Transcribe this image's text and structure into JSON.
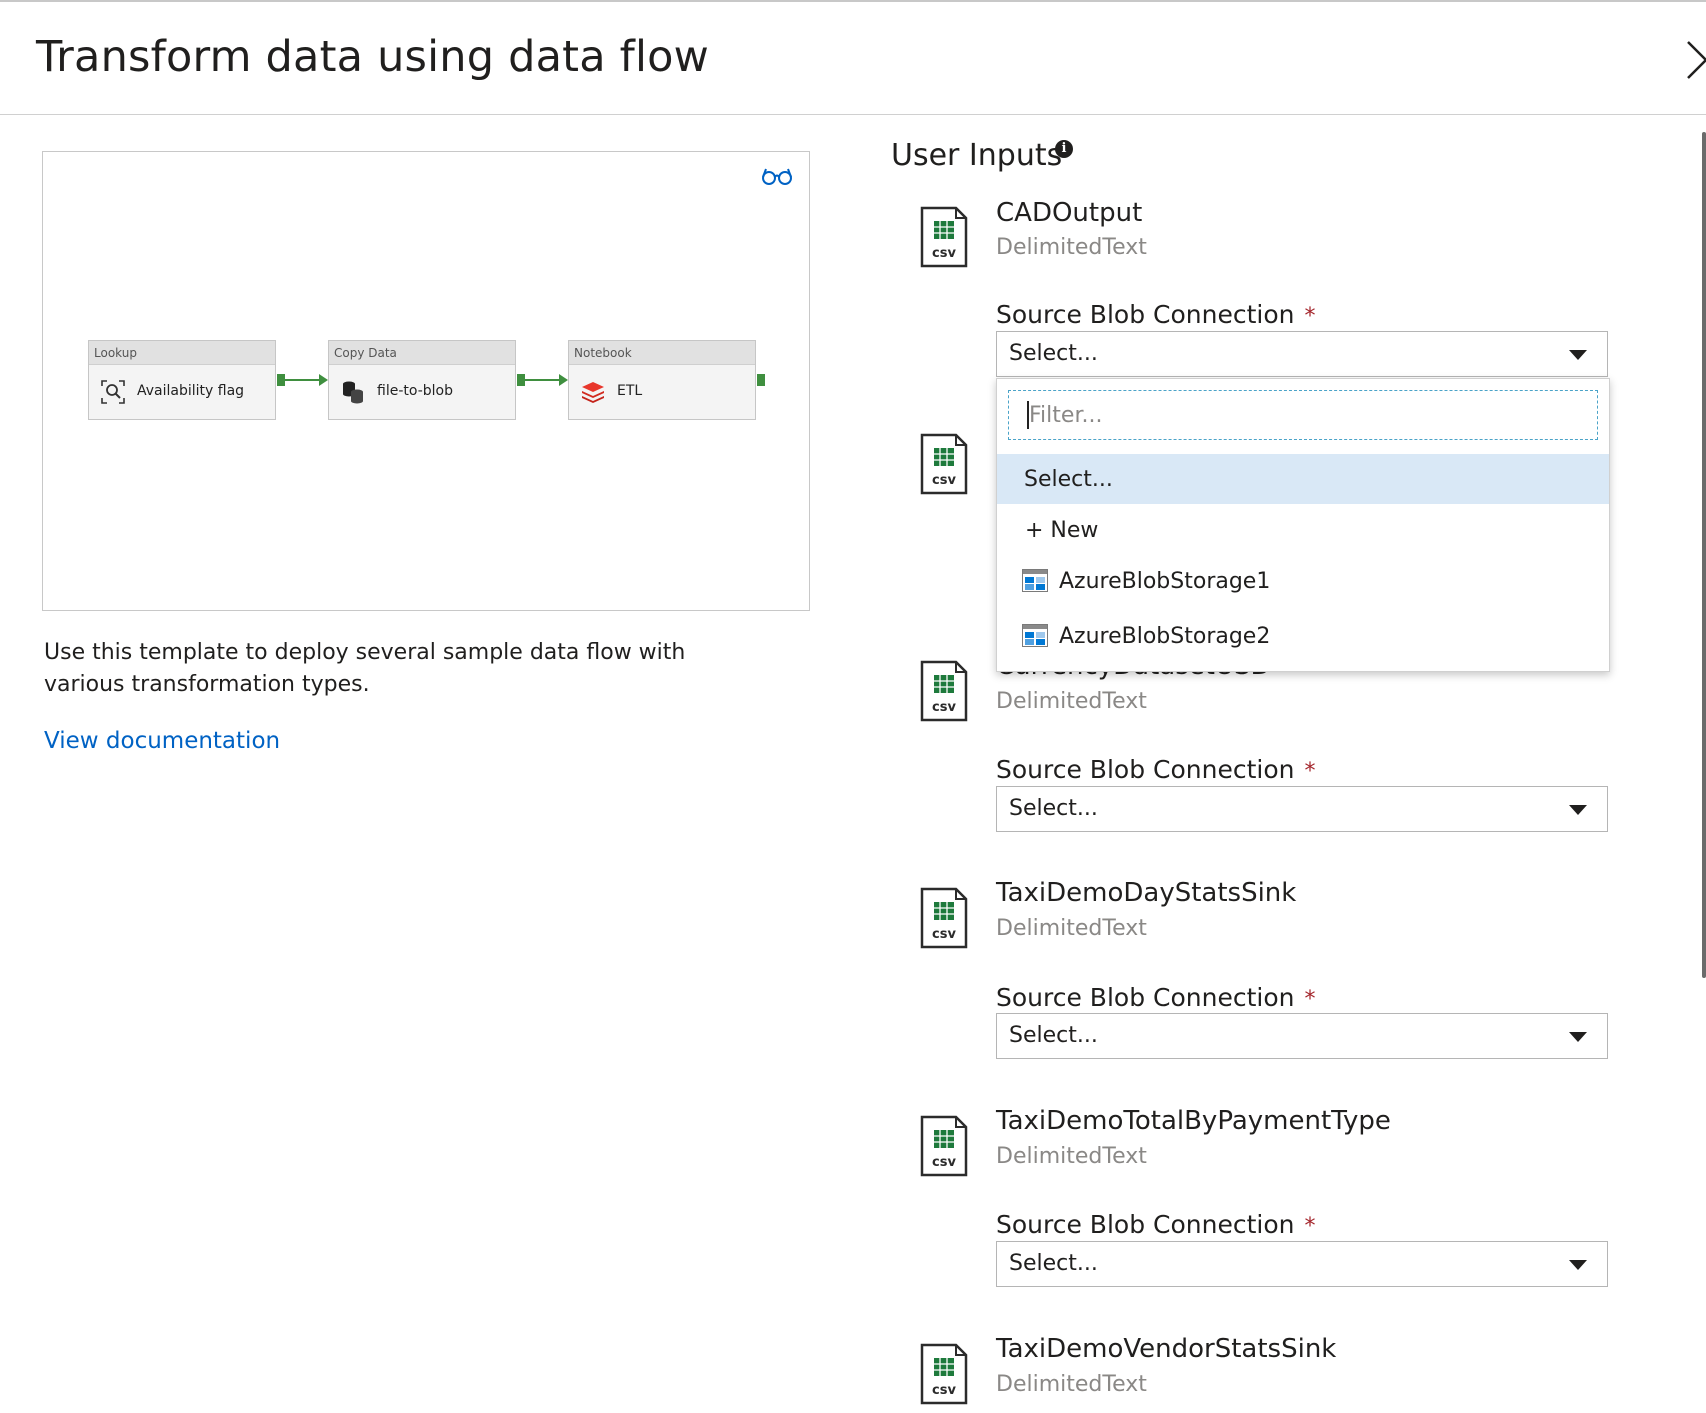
{
  "panel": {
    "title": "Transform data using data flow"
  },
  "preview": {
    "activities": [
      {
        "type": "Lookup",
        "label": "Availability flag",
        "icon": "lookup-icon"
      },
      {
        "type": "Copy Data",
        "label": "file-to-blob",
        "icon": "copy-data-icon"
      },
      {
        "type": "Notebook",
        "label": "ETL",
        "icon": "notebook-icon"
      }
    ],
    "description": "Use this template to deploy several sample data flow with various transformation types.",
    "doc_link": "View documentation"
  },
  "user_inputs": {
    "heading": "User Inputs",
    "field_label": "Source Blob Connection",
    "required_mark": "*",
    "datasets": [
      {
        "name": "CADOutput",
        "type": "DelimitedText",
        "value": "Select..."
      },
      {
        "name": "",
        "type": "",
        "value": ""
      },
      {
        "name": "CurrencyDatasetUSD",
        "type": "DelimitedText",
        "value": "Select..."
      },
      {
        "name": "TaxiDemoDayStatsSink",
        "type": "DelimitedText",
        "value": "Select..."
      },
      {
        "name": "TaxiDemoTotalByPaymentType",
        "type": "DelimitedText",
        "value": "Select..."
      },
      {
        "name": "TaxiDemoVendorStatsSink",
        "type": "DelimitedText"
      }
    ],
    "icon_label": "csv"
  },
  "dropdown": {
    "filter_placeholder": "Filter...",
    "options": [
      {
        "label": "Select...",
        "selected": true
      },
      {
        "label": "+ New"
      },
      {
        "label": "AzureBlobStorage1",
        "icon": "blob-storage-icon"
      },
      {
        "label": "AzureBlobStorage2",
        "icon": "blob-storage-icon"
      }
    ]
  },
  "colors": {
    "link": "#0062c4",
    "pipeline_green": "#3f8f3f",
    "selected_option": "#d9e8f6",
    "required": "#a4262c"
  }
}
